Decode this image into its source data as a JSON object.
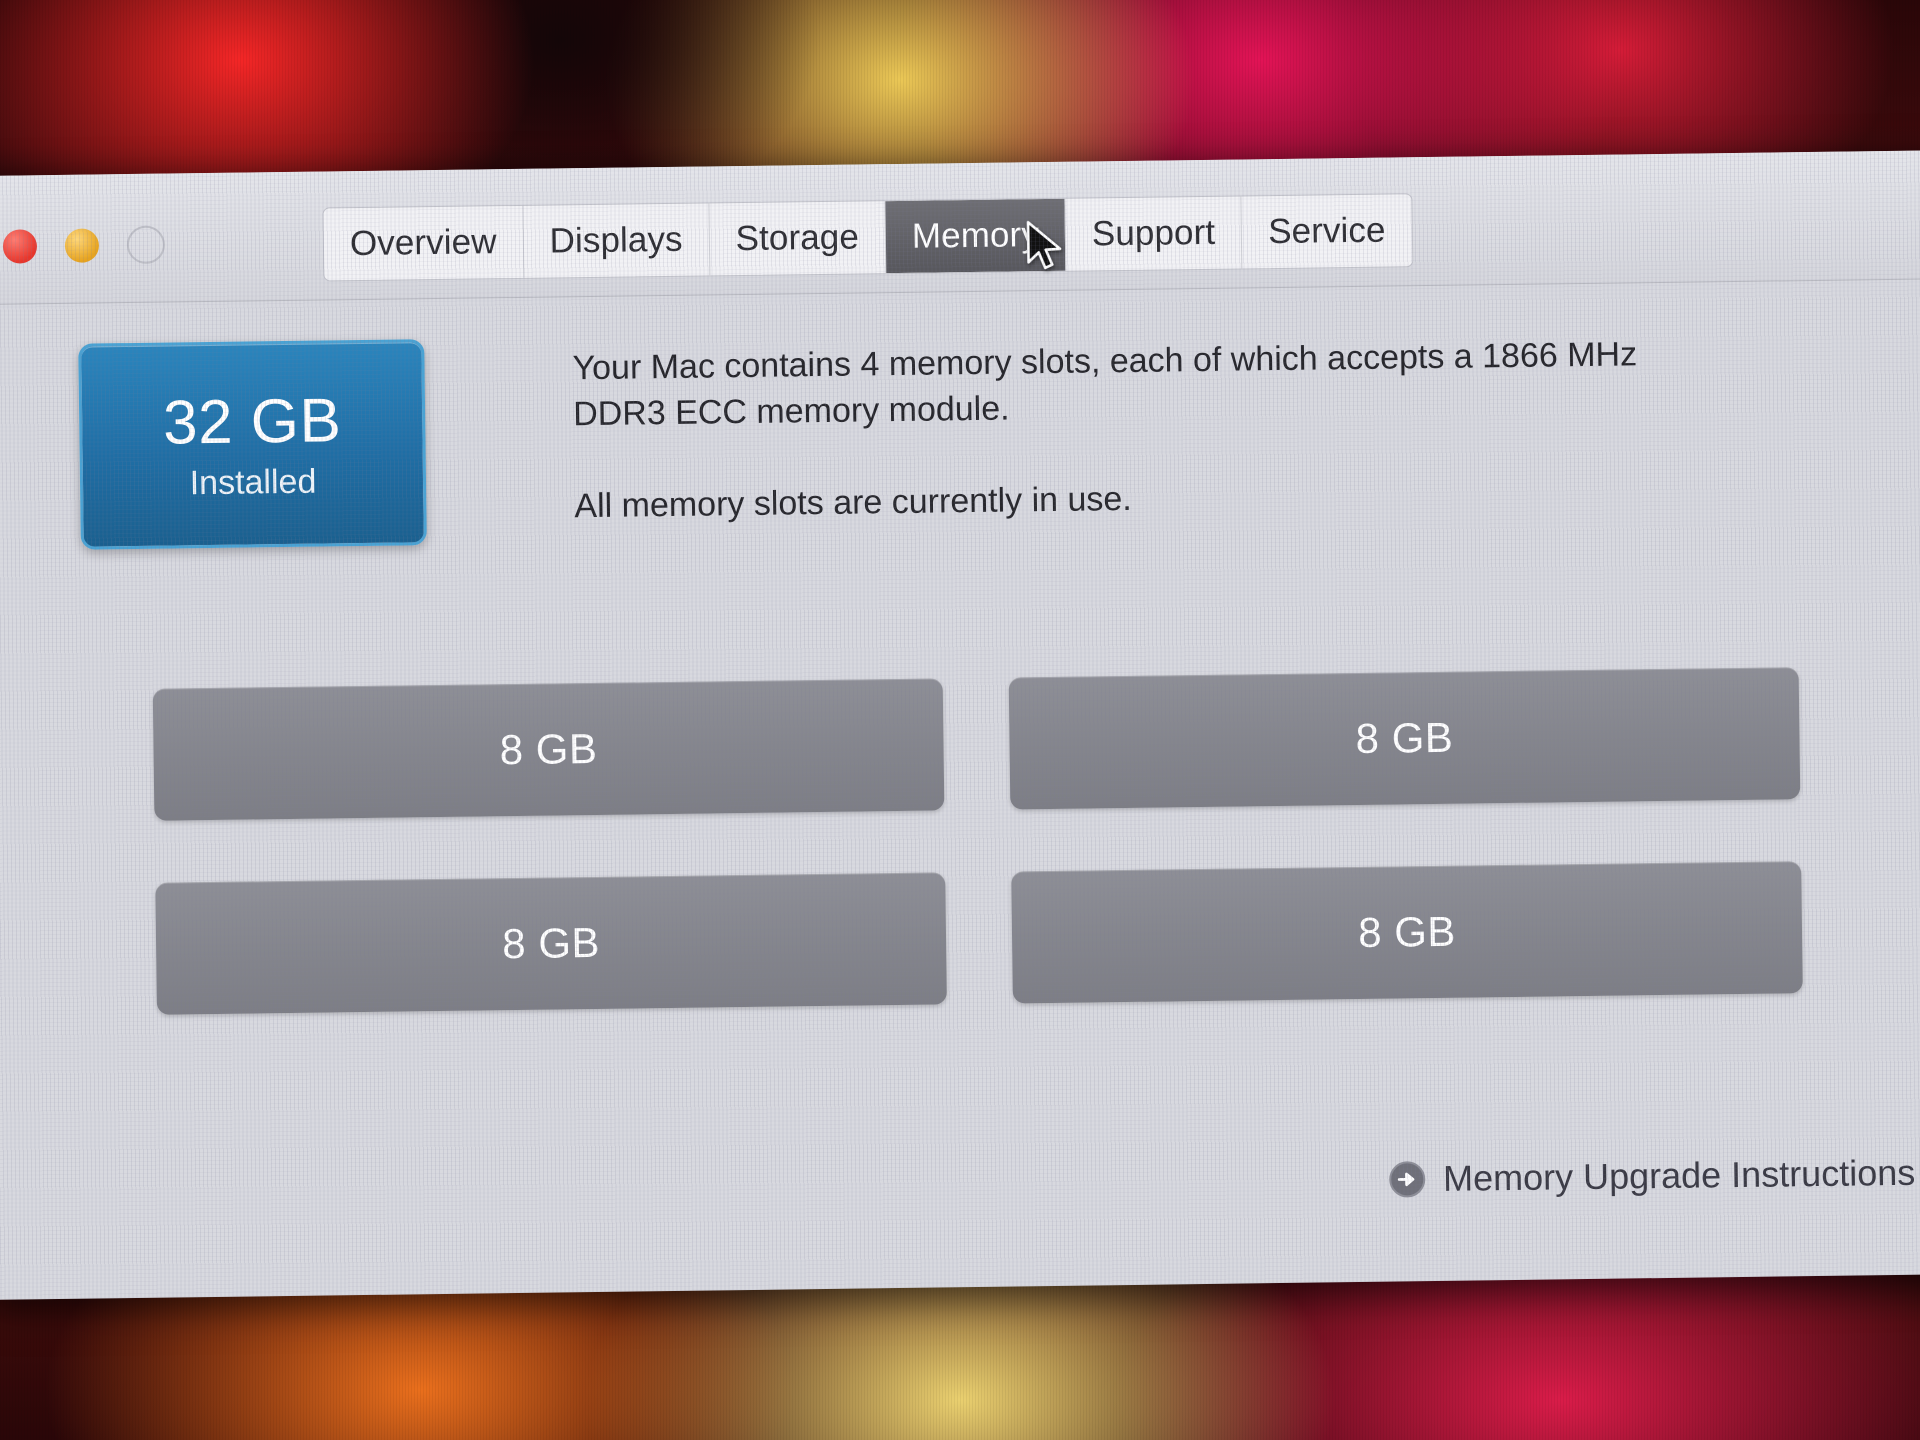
{
  "window": {
    "traffic_lights": [
      {
        "name": "close",
        "color": "#e8352a",
        "enabled": true
      },
      {
        "name": "minimize",
        "color": "#e8a41e",
        "enabled": true
      },
      {
        "name": "zoom",
        "color": "#bfc0c7",
        "enabled": false
      }
    ]
  },
  "tabs": [
    {
      "label": "Overview",
      "active": false
    },
    {
      "label": "Displays",
      "active": false
    },
    {
      "label": "Storage",
      "active": false
    },
    {
      "label": "Memory",
      "active": true
    },
    {
      "label": "Support",
      "active": false
    },
    {
      "label": "Service",
      "active": false
    }
  ],
  "memory": {
    "badge": {
      "size": "32 GB",
      "state": "Installed",
      "accent": "#1f6ea5"
    },
    "description": {
      "paragraph_1": "Your Mac contains 4 memory slots, each of which accepts a 1866 MHz DDR3 ECC memory module.",
      "paragraph_2": "All memory slots are currently in use."
    },
    "slots": [
      {
        "label": "8 GB"
      },
      {
        "label": "8 GB"
      },
      {
        "label": "8 GB"
      },
      {
        "label": "8 GB"
      }
    ],
    "upgrade_link": {
      "label": "Memory Upgrade Instructions",
      "icon": "arrow-right-circle-icon"
    }
  }
}
